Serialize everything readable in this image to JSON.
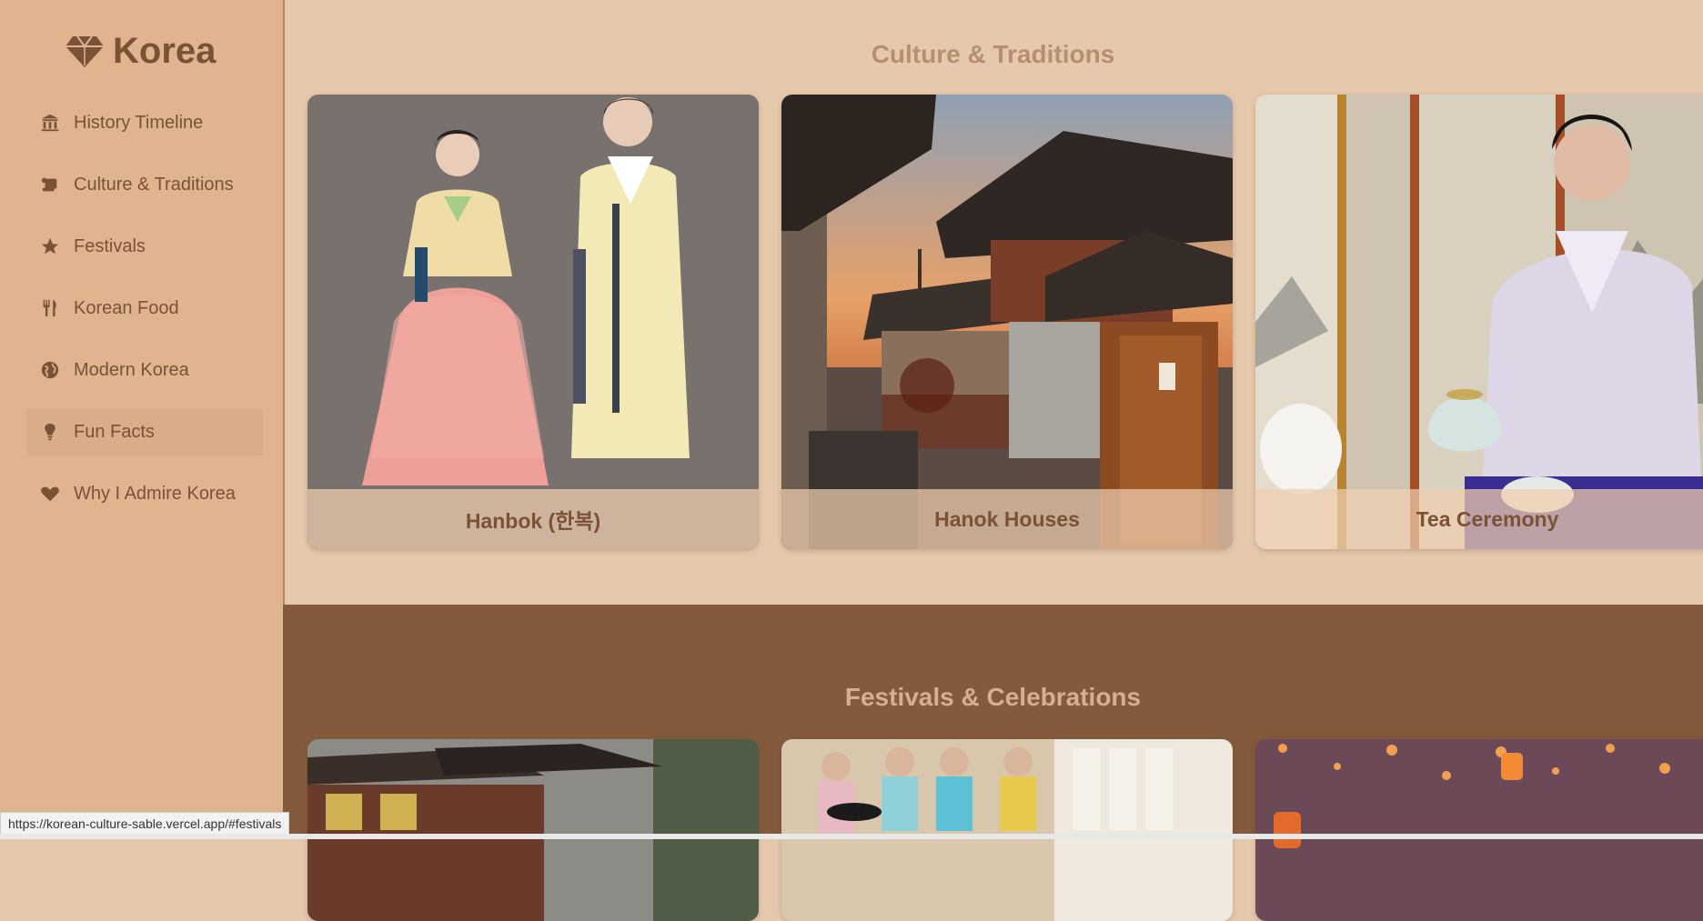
{
  "sidebar": {
    "logo": {
      "icon": "gem-icon",
      "text": "Korea"
    },
    "items": [
      {
        "label": "History Timeline",
        "icon": "landmark-icon"
      },
      {
        "label": "Culture & Traditions",
        "icon": "scroll-icon"
      },
      {
        "label": "Festivals",
        "icon": "star-icon"
      },
      {
        "label": "Korean Food",
        "icon": "utensils-icon"
      },
      {
        "label": "Modern Korea",
        "icon": "globe-icon"
      },
      {
        "label": "Fun Facts",
        "icon": "lightbulb-icon"
      },
      {
        "label": "Why I Admire Korea",
        "icon": "heart-icon"
      }
    ]
  },
  "culture": {
    "title": "Culture & Traditions",
    "cards": [
      {
        "caption": "Hanbok (한복)"
      },
      {
        "caption": "Hanok Houses"
      },
      {
        "caption": "Tea Ceremony"
      }
    ]
  },
  "festivals": {
    "title": "Festivals & Celebrations"
  },
  "status": {
    "url": "https://korean-culture-sable.vercel.app/#festivals"
  },
  "colors": {
    "sidebar": "#dfb48f",
    "main_bg": "#e6c9ad",
    "accent_text": "#7b5236",
    "festivals_bg": "#835a3c"
  }
}
